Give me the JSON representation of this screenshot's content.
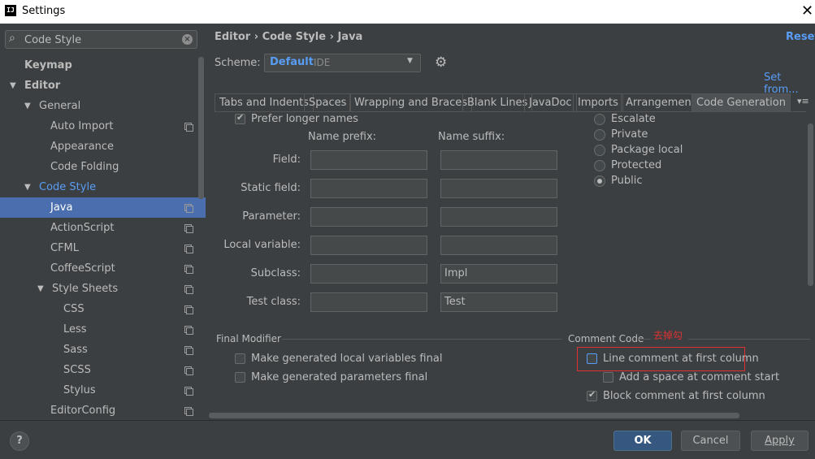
{
  "window": {
    "title": "Settings",
    "app_icon": "IJ"
  },
  "search": {
    "value": "Code Style"
  },
  "tree": [
    {
      "label": "Keymap",
      "bold": true
    },
    {
      "label": "Editor",
      "bold": true,
      "arrow": "▼"
    },
    {
      "label": "General",
      "arrow": "▼"
    },
    {
      "label": "Auto Import",
      "copy": true
    },
    {
      "label": "Appearance"
    },
    {
      "label": "Code Folding"
    },
    {
      "label": "Code Style",
      "arrow": "▼",
      "blue": true
    },
    {
      "label": "Java",
      "copy": true,
      "selected": true
    },
    {
      "label": "ActionScript",
      "copy": true
    },
    {
      "label": "CFML",
      "copy": true
    },
    {
      "label": "CoffeeScript",
      "copy": true
    },
    {
      "label": "Style Sheets",
      "arrow": "▼",
      "copy": true
    },
    {
      "label": "CSS",
      "copy": true
    },
    {
      "label": "Less",
      "copy": true
    },
    {
      "label": "Sass",
      "copy": true
    },
    {
      "label": "SCSS",
      "copy": true
    },
    {
      "label": "Stylus",
      "copy": true
    },
    {
      "label": "EditorConfig",
      "copy": true
    }
  ],
  "breadcrumb": {
    "text": "Editor  ›  Code Style  ›  Java"
  },
  "reset_label": "Reset",
  "scheme": {
    "label": "Scheme:",
    "name": "Default",
    "kind": "IDE"
  },
  "set_from_label": "Set from...",
  "tabs": [
    "Tabs and Indents",
    "Spaces",
    "Wrapping and Braces",
    "Blank Lines",
    "JavaDoc",
    "Imports",
    "Arrangement",
    "Code Generation"
  ],
  "naming": {
    "prefer_longer": "Prefer longer names",
    "prefix_header": "Name prefix:",
    "suffix_header": "Name suffix:",
    "rows": [
      {
        "label": "Field:",
        "prefix": "",
        "suffix": ""
      },
      {
        "label": "Static field:",
        "prefix": "",
        "suffix": ""
      },
      {
        "label": "Parameter:",
        "prefix": "",
        "suffix": ""
      },
      {
        "label": "Local variable:",
        "prefix": "",
        "suffix": ""
      },
      {
        "label": "Subclass:",
        "prefix": "",
        "suffix": "Impl"
      },
      {
        "label": "Test class:",
        "prefix": "",
        "suffix": "Test"
      }
    ]
  },
  "visibility": [
    "Escalate",
    "Private",
    "Package local",
    "Protected",
    "Public"
  ],
  "final_modifier": {
    "title": "Final Modifier",
    "local_vars": "Make generated local variables final",
    "params": "Make generated parameters final"
  },
  "comment_code": {
    "title": "Comment Code",
    "annotation": "去掉勾",
    "line_first_col": "Line comment at first column",
    "add_space": "Add a space at comment start",
    "block_first_col": "Block comment at first column"
  },
  "buttons": {
    "help": "?",
    "ok": "OK",
    "cancel": "Cancel",
    "apply": "Apply"
  },
  "colors": {
    "accent": "#589df6",
    "selection": "#4b6eaf",
    "annotation": "#e03030"
  }
}
